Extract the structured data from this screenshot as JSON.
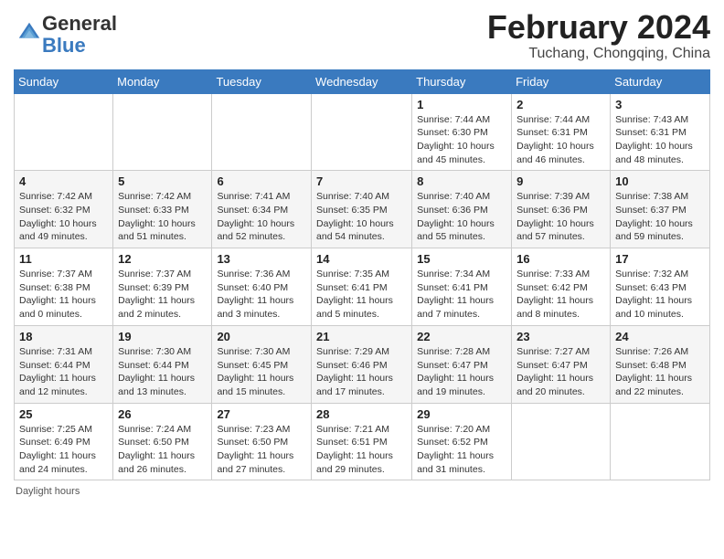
{
  "header": {
    "logo_general": "General",
    "logo_blue": "Blue",
    "month_year": "February 2024",
    "location": "Tuchang, Chongqing, China"
  },
  "days_of_week": [
    "Sunday",
    "Monday",
    "Tuesday",
    "Wednesday",
    "Thursday",
    "Friday",
    "Saturday"
  ],
  "weeks": [
    [
      {
        "day": "",
        "info": ""
      },
      {
        "day": "",
        "info": ""
      },
      {
        "day": "",
        "info": ""
      },
      {
        "day": "",
        "info": ""
      },
      {
        "day": "1",
        "info": "Sunrise: 7:44 AM\nSunset: 6:30 PM\nDaylight: 10 hours\nand 45 minutes."
      },
      {
        "day": "2",
        "info": "Sunrise: 7:44 AM\nSunset: 6:31 PM\nDaylight: 10 hours\nand 46 minutes."
      },
      {
        "day": "3",
        "info": "Sunrise: 7:43 AM\nSunset: 6:31 PM\nDaylight: 10 hours\nand 48 minutes."
      }
    ],
    [
      {
        "day": "4",
        "info": "Sunrise: 7:42 AM\nSunset: 6:32 PM\nDaylight: 10 hours\nand 49 minutes."
      },
      {
        "day": "5",
        "info": "Sunrise: 7:42 AM\nSunset: 6:33 PM\nDaylight: 10 hours\nand 51 minutes."
      },
      {
        "day": "6",
        "info": "Sunrise: 7:41 AM\nSunset: 6:34 PM\nDaylight: 10 hours\nand 52 minutes."
      },
      {
        "day": "7",
        "info": "Sunrise: 7:40 AM\nSunset: 6:35 PM\nDaylight: 10 hours\nand 54 minutes."
      },
      {
        "day": "8",
        "info": "Sunrise: 7:40 AM\nSunset: 6:36 PM\nDaylight: 10 hours\nand 55 minutes."
      },
      {
        "day": "9",
        "info": "Sunrise: 7:39 AM\nSunset: 6:36 PM\nDaylight: 10 hours\nand 57 minutes."
      },
      {
        "day": "10",
        "info": "Sunrise: 7:38 AM\nSunset: 6:37 PM\nDaylight: 10 hours\nand 59 minutes."
      }
    ],
    [
      {
        "day": "11",
        "info": "Sunrise: 7:37 AM\nSunset: 6:38 PM\nDaylight: 11 hours\nand 0 minutes."
      },
      {
        "day": "12",
        "info": "Sunrise: 7:37 AM\nSunset: 6:39 PM\nDaylight: 11 hours\nand 2 minutes."
      },
      {
        "day": "13",
        "info": "Sunrise: 7:36 AM\nSunset: 6:40 PM\nDaylight: 11 hours\nand 3 minutes."
      },
      {
        "day": "14",
        "info": "Sunrise: 7:35 AM\nSunset: 6:41 PM\nDaylight: 11 hours\nand 5 minutes."
      },
      {
        "day": "15",
        "info": "Sunrise: 7:34 AM\nSunset: 6:41 PM\nDaylight: 11 hours\nand 7 minutes."
      },
      {
        "day": "16",
        "info": "Sunrise: 7:33 AM\nSunset: 6:42 PM\nDaylight: 11 hours\nand 8 minutes."
      },
      {
        "day": "17",
        "info": "Sunrise: 7:32 AM\nSunset: 6:43 PM\nDaylight: 11 hours\nand 10 minutes."
      }
    ],
    [
      {
        "day": "18",
        "info": "Sunrise: 7:31 AM\nSunset: 6:44 PM\nDaylight: 11 hours\nand 12 minutes."
      },
      {
        "day": "19",
        "info": "Sunrise: 7:30 AM\nSunset: 6:44 PM\nDaylight: 11 hours\nand 13 minutes."
      },
      {
        "day": "20",
        "info": "Sunrise: 7:30 AM\nSunset: 6:45 PM\nDaylight: 11 hours\nand 15 minutes."
      },
      {
        "day": "21",
        "info": "Sunrise: 7:29 AM\nSunset: 6:46 PM\nDaylight: 11 hours\nand 17 minutes."
      },
      {
        "day": "22",
        "info": "Sunrise: 7:28 AM\nSunset: 6:47 PM\nDaylight: 11 hours\nand 19 minutes."
      },
      {
        "day": "23",
        "info": "Sunrise: 7:27 AM\nSunset: 6:47 PM\nDaylight: 11 hours\nand 20 minutes."
      },
      {
        "day": "24",
        "info": "Sunrise: 7:26 AM\nSunset: 6:48 PM\nDaylight: 11 hours\nand 22 minutes."
      }
    ],
    [
      {
        "day": "25",
        "info": "Sunrise: 7:25 AM\nSunset: 6:49 PM\nDaylight: 11 hours\nand 24 minutes."
      },
      {
        "day": "26",
        "info": "Sunrise: 7:24 AM\nSunset: 6:50 PM\nDaylight: 11 hours\nand 26 minutes."
      },
      {
        "day": "27",
        "info": "Sunrise: 7:23 AM\nSunset: 6:50 PM\nDaylight: 11 hours\nand 27 minutes."
      },
      {
        "day": "28",
        "info": "Sunrise: 7:21 AM\nSunset: 6:51 PM\nDaylight: 11 hours\nand 29 minutes."
      },
      {
        "day": "29",
        "info": "Sunrise: 7:20 AM\nSunset: 6:52 PM\nDaylight: 11 hours\nand 31 minutes."
      },
      {
        "day": "",
        "info": ""
      },
      {
        "day": "",
        "info": ""
      }
    ]
  ],
  "footer": {
    "daylight_label": "Daylight hours"
  }
}
